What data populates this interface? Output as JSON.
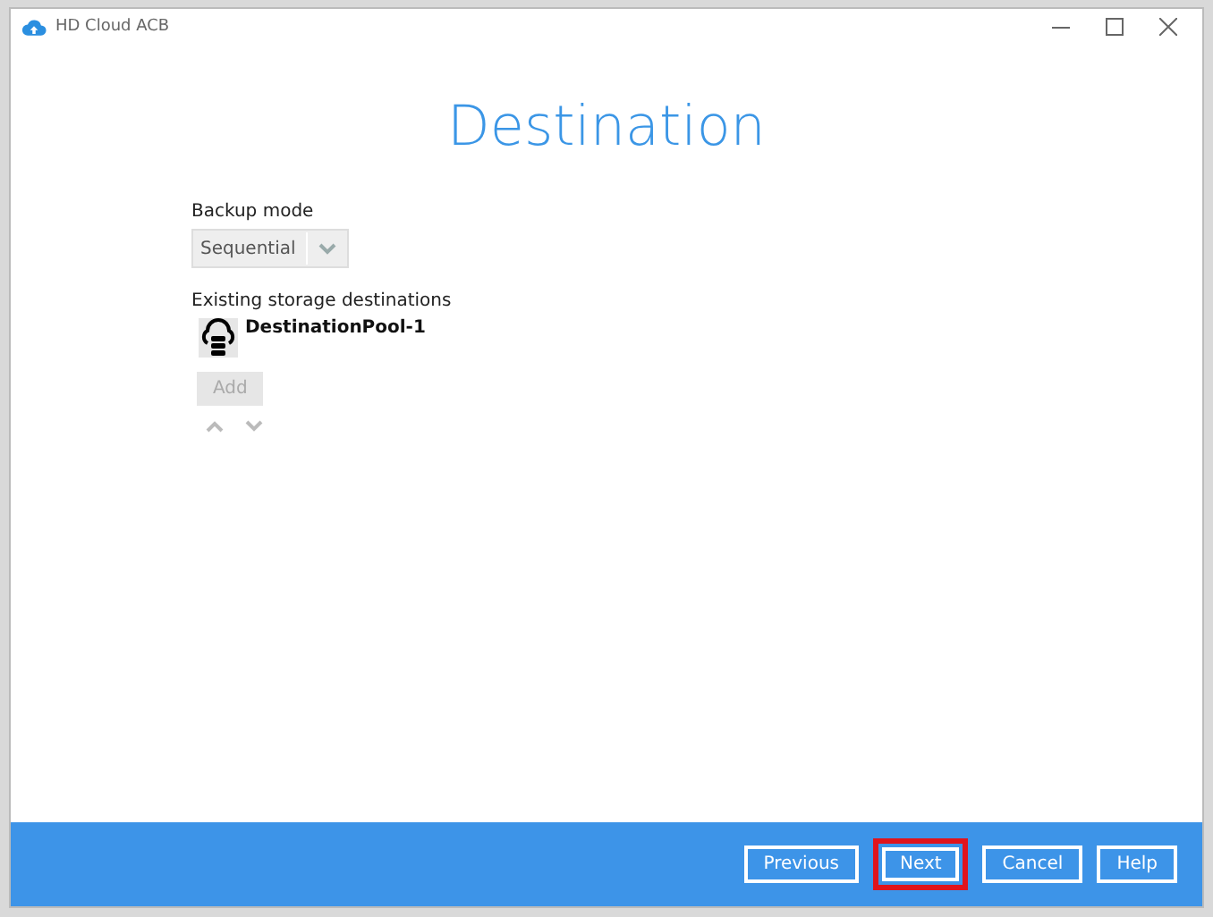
{
  "window": {
    "title": "HD Cloud ACB"
  },
  "heading": "Destination",
  "backup_mode": {
    "label": "Backup mode",
    "value": "Sequential",
    "disabled": true
  },
  "destinations": {
    "label": "Existing storage destinations",
    "items": [
      {
        "name": "DestinationPool-1"
      }
    ]
  },
  "add_button": {
    "label": "Add",
    "disabled": true
  },
  "buttons": [
    {
      "label": "Previous",
      "highlighted": false
    },
    {
      "label": "Next",
      "highlighted": true
    },
    {
      "label": "Cancel",
      "highlighted": false
    },
    {
      "label": "Help",
      "highlighted": false
    }
  ]
}
